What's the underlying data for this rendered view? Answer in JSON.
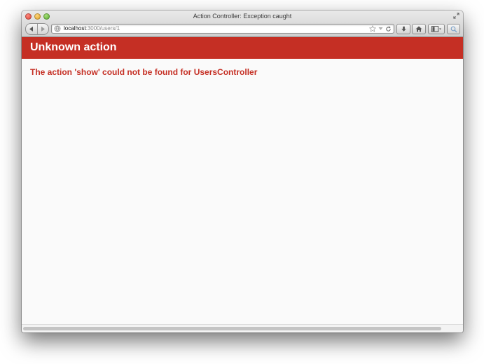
{
  "window": {
    "title": "Action Controller: Exception caught"
  },
  "toolbar": {
    "url_host": "localhost",
    "url_rest": ":3000/users/1",
    "icons": [
      "back-icon",
      "forward-icon",
      "site-globe-icon",
      "bookmark-star-icon",
      "dropdown-arrow-icon",
      "reload-icon",
      "downloads-icon",
      "home-icon",
      "sidebar-icon",
      "search-icon",
      "fullscreen-icon"
    ]
  },
  "page": {
    "heading": "Unknown action",
    "message": "The action 'show' could not be found for UsersController"
  },
  "colors": {
    "header_bg": "#c52f24",
    "message_text": "#c52f24",
    "page_bg": "#fafafa"
  }
}
